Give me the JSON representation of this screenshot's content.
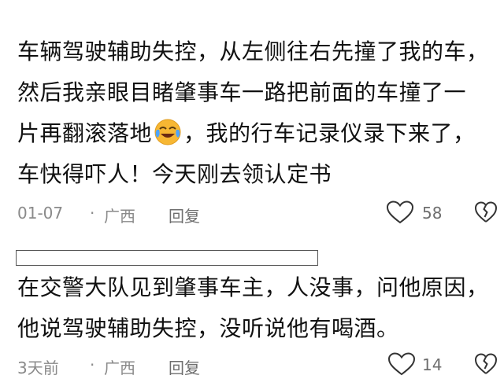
{
  "comments": [
    {
      "lines": [
        "车辆驾驶辅助失控，从左侧往右先撞了我的车，",
        "然后我亲眼目睹肇事车一路把前面的车撞了一",
        "片再翻滚落地",
        "，我的行车记录仪录下来了，",
        "车快得吓人！今天刚去领认定书"
      ],
      "emoji": "crying-laughing-emoji",
      "date": "01-07",
      "separator": "·",
      "location": "广西",
      "reply_label": "回复",
      "likes": "58"
    },
    {
      "lines": [
        "在交警大队见到肇事车主，人没事，问他原因，",
        "他说驾驶辅助失控，没听说他有喝酒。"
      ],
      "date": "3天前",
      "separator": "·",
      "location": "广西",
      "reply_label": "回复",
      "likes": "14"
    }
  ],
  "icons": {
    "like": "heart-outline-icon",
    "dislike": "broken-heart-icon"
  },
  "colors": {
    "text": "#111111",
    "meta": "#8a8a8a",
    "emoji": "#f7b733"
  }
}
